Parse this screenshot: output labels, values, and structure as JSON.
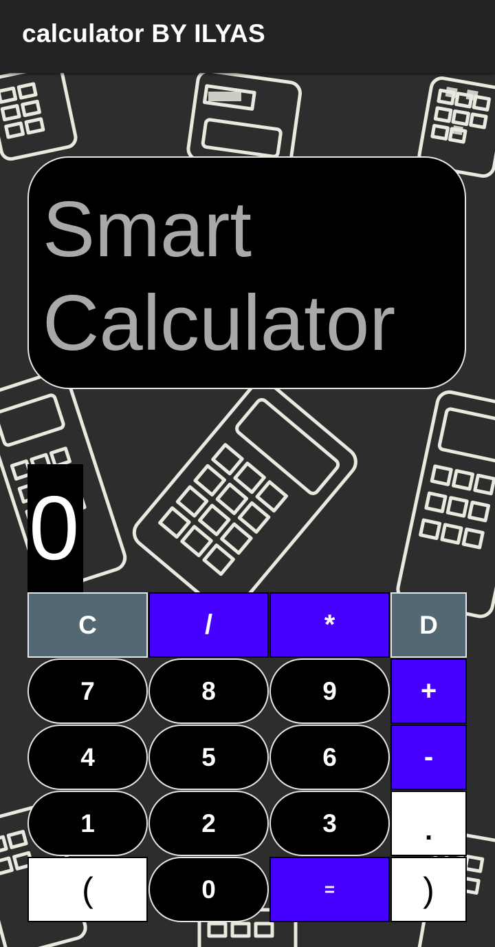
{
  "app_bar": {
    "title": "calculator BY ILYAS"
  },
  "title_card": {
    "line1": "Smart",
    "line2": "Calculator"
  },
  "display": {
    "value": "0"
  },
  "keys": {
    "clear": "C",
    "divide": "/",
    "multiply": "*",
    "delete": "D",
    "seven": "7",
    "eight": "8",
    "nine": "9",
    "plus": "+",
    "four": "4",
    "five": "5",
    "six": "6",
    "minus": "-",
    "one": "1",
    "two": "2",
    "three": "3",
    "dot": ".",
    "open_paren": "(",
    "zero": "0",
    "equals": "=",
    "close_paren": ")"
  },
  "colors": {
    "app_bar": "#232323",
    "background": "#2d2d2d",
    "accent_blue": "#4500ff",
    "gray_key": "#546873",
    "title_text": "#a9a9a9"
  },
  "icons": {
    "background_pattern": "calculator-sketch-pattern"
  }
}
